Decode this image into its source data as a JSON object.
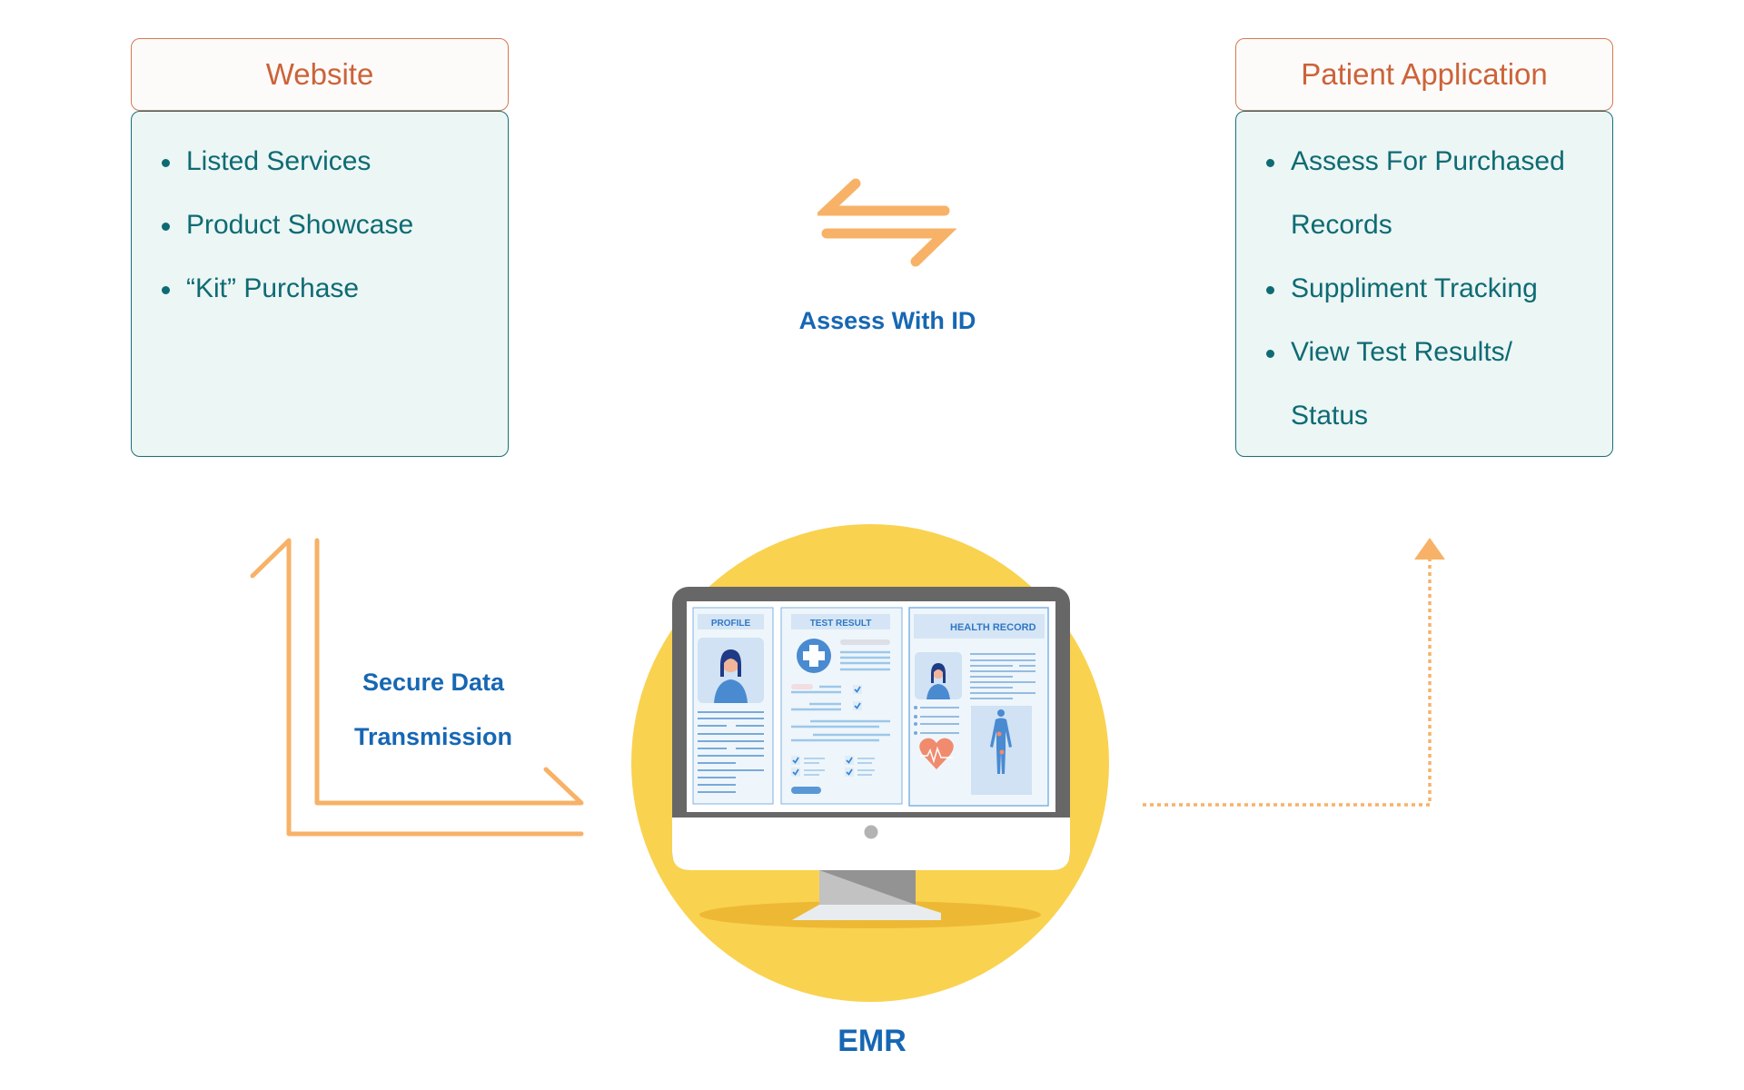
{
  "website": {
    "title": "Website",
    "items": [
      "Listed Services",
      "Product Showcase",
      "“Kit” Purchase"
    ]
  },
  "patient_app": {
    "title": "Patient Application",
    "items": [
      {
        "line1": "Assess For Purchased",
        "line2": "Records"
      },
      {
        "line1": "Suppliment Tracking"
      },
      {
        "line1": "View Test Results/",
        "line2": "Status"
      }
    ]
  },
  "connectors": {
    "exchange_label": "Assess With ID",
    "secure_line1": "Secure Data",
    "secure_line2": "Transmission"
  },
  "emr": {
    "label": "EMR",
    "screen": {
      "panel1_title": "PROFILE",
      "panel2_title": "TEST RESULT",
      "panel3_title": "HEALTH RECORD"
    }
  },
  "colors": {
    "header_text": "#cc6338",
    "header_border": "#d47a52",
    "body_text": "#0e6b73",
    "body_bg": "#ecf6f5",
    "arrow": "#f7b267",
    "label_blue": "#1767b3",
    "circle": "#f9d250"
  }
}
